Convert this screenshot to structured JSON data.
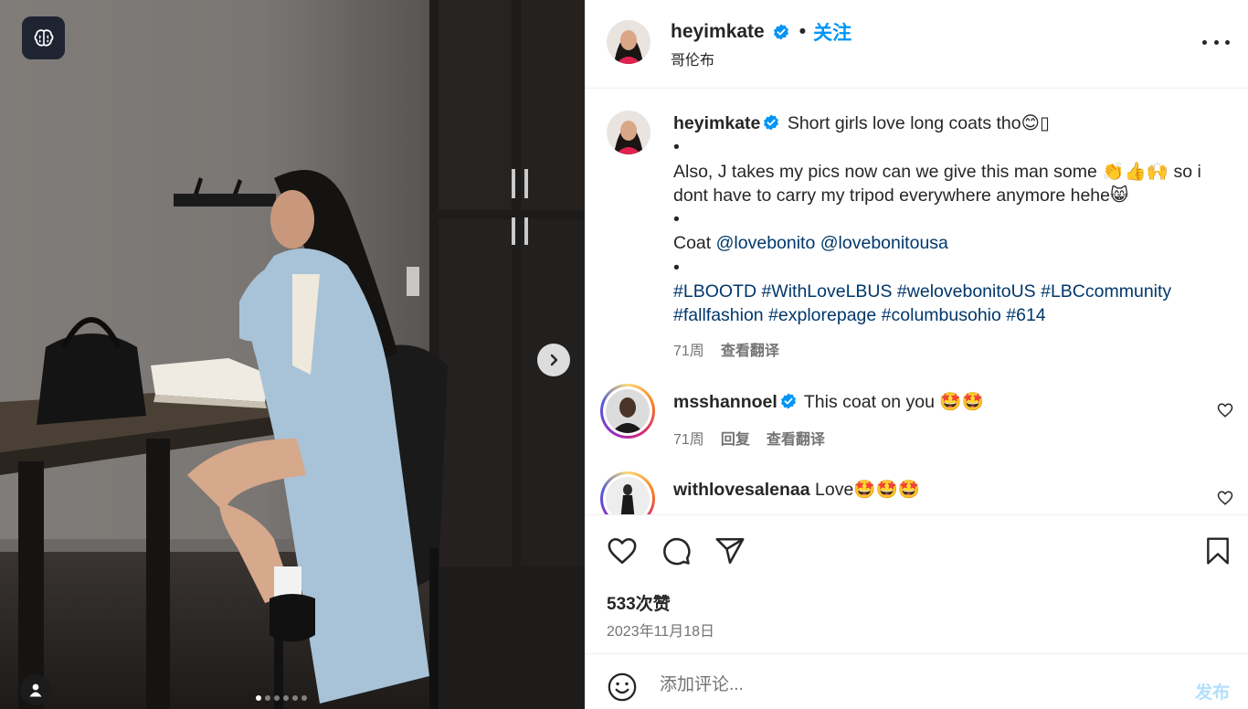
{
  "photo": {
    "brain_icon": "brain-icon",
    "next_icon": "chevron-right-icon",
    "user_tag_icon": "user-icon",
    "carousel_total": 6,
    "carousel_active_index": 0
  },
  "header": {
    "username": "heyimkate",
    "separator": "•",
    "follow_label": "关注",
    "location": "哥伦布"
  },
  "caption": {
    "username": "heyimkate",
    "line1": "Short girls love long coats tho😊▯",
    "bullet": "•",
    "line2": "Also, J takes my pics now can we give this man some 👏👍🙌 so i dont have to carry my tripod everywhere anymore hehe😸",
    "coat_label": "Coat",
    "mention1": "@lovebonito",
    "mention2": "@lovebonitousa",
    "hashtags_line1": "#LBOOTD #WithLoveLBUS #welovebonitoUS #LBCcommunity",
    "hashtags_line2": "#fallfashion #explorepage #columbusohio #614",
    "age": "71周",
    "translate": "查看翻译"
  },
  "comments": [
    {
      "username": "msshannoel",
      "verified": true,
      "text": "This coat on you 🤩🤩",
      "age": "71周",
      "reply": "回复",
      "translate": "查看翻译"
    },
    {
      "username": "withlovesalenaa",
      "verified": false,
      "text": "Love🤩🤩🤩"
    }
  ],
  "actions": {
    "likes": "533次赞",
    "date": "2023年11月18日"
  },
  "add_comment": {
    "placeholder": "添加评论...",
    "post_label": "发布"
  },
  "colors": {
    "link": "#00376b",
    "follow": "#0095f6",
    "verified": "#0095f6",
    "muted": "#737373"
  }
}
